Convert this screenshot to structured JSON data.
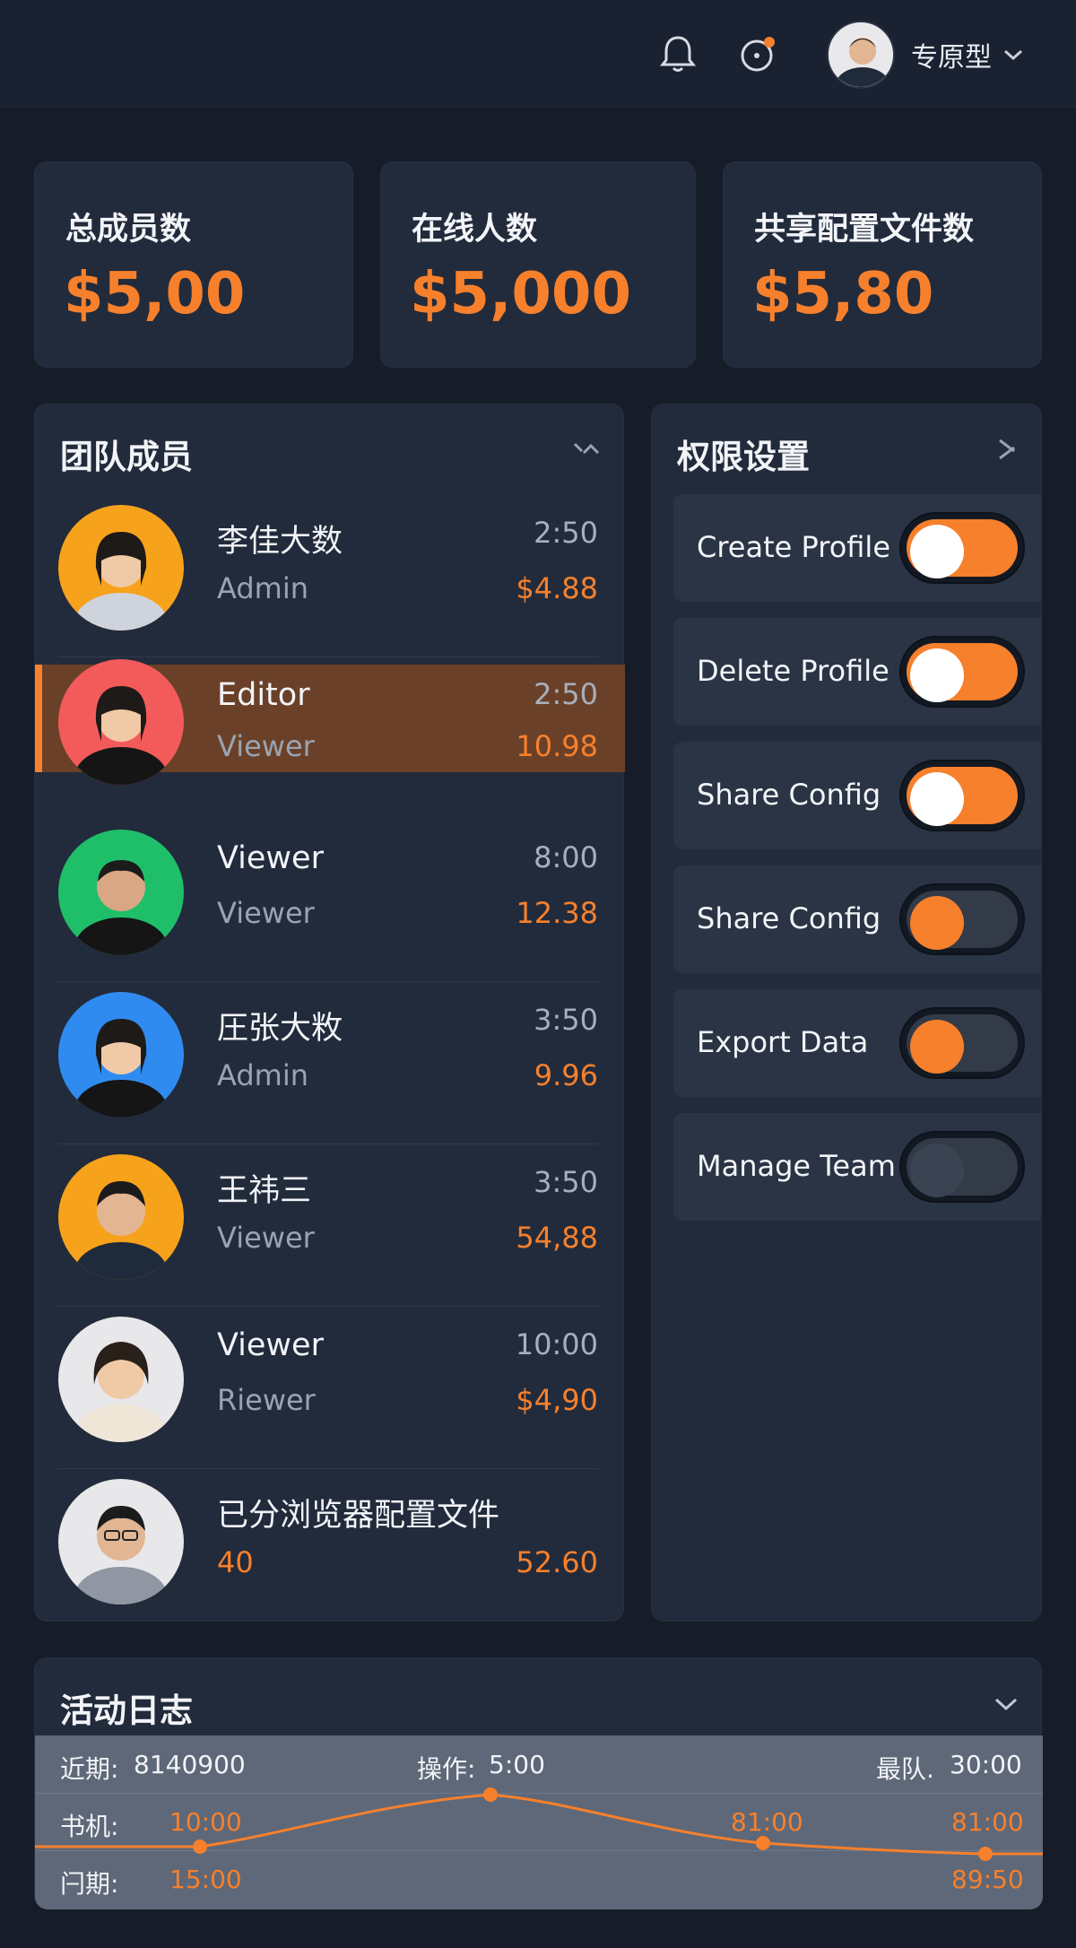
{
  "topbar": {
    "icons": [
      "bell-icon",
      "notification-dot-icon"
    ],
    "username": "专原型",
    "accent": "#f7802c"
  },
  "stats": [
    {
      "title": "总成员数",
      "value": "$5,00"
    },
    {
      "title": "在线人数",
      "value": "$5,000"
    },
    {
      "title": "共享配置文件数",
      "value": "$5,80"
    }
  ],
  "team": {
    "title": "团队成员",
    "members": [
      {
        "name": "李佳大数",
        "role": "Admin",
        "time": "2:50",
        "amount": "$4.88",
        "color": "#f7a21b"
      },
      {
        "name": "Editor",
        "role": "Viewer",
        "time": "2:50",
        "amount": "10.98",
        "color": "#f35b5b",
        "selected": true
      },
      {
        "name": "Viewer",
        "role": "Viewer",
        "time": "8:00",
        "amount": "12.38",
        "color": "#1fbf6a"
      },
      {
        "name": "圧张大敉",
        "role": "Admin",
        "time": "3:50",
        "amount": "9.96",
        "color": "#2f8bf0"
      },
      {
        "name": "王祎三",
        "role": "Viewer",
        "time": "3:50",
        "amount": "54,88",
        "color": "#f7a21b"
      },
      {
        "name": "Viewer",
        "role": "Riewer",
        "time": "10:00",
        "amount": "$4,90",
        "color": "#e8e8ea"
      },
      {
        "name": "已分浏览器配置文件",
        "role": "40",
        "time": "",
        "amount": "52.60",
        "color": "#e8e8ea"
      }
    ]
  },
  "permissions": {
    "title": "权限设置",
    "items": [
      {
        "label": "Create Profile",
        "on": true
      },
      {
        "label": "Delete Profile",
        "on": true
      },
      {
        "label": "Share Config",
        "on": true
      },
      {
        "label": "Share Config",
        "on": false,
        "knob_orange": true
      },
      {
        "label": "Export Data",
        "on": false,
        "knob_orange": true
      },
      {
        "label": "Manage Team",
        "on": false,
        "knob_orange": false
      }
    ]
  },
  "activity": {
    "title": "活动日志",
    "rows": [
      {
        "a": "近期:",
        "b": "8140900",
        "c": "操作:",
        "d": "5:00",
        "e": "最队.",
        "f": "30:00"
      },
      {
        "a": "书机:",
        "b": "10:00",
        "c": "",
        "d": "81:00",
        "e": "",
        "f": "81:00"
      },
      {
        "a": "闩期:",
        "b": "15:00",
        "c": "",
        "d": "",
        "e": "",
        "f": "89:50"
      }
    ]
  }
}
